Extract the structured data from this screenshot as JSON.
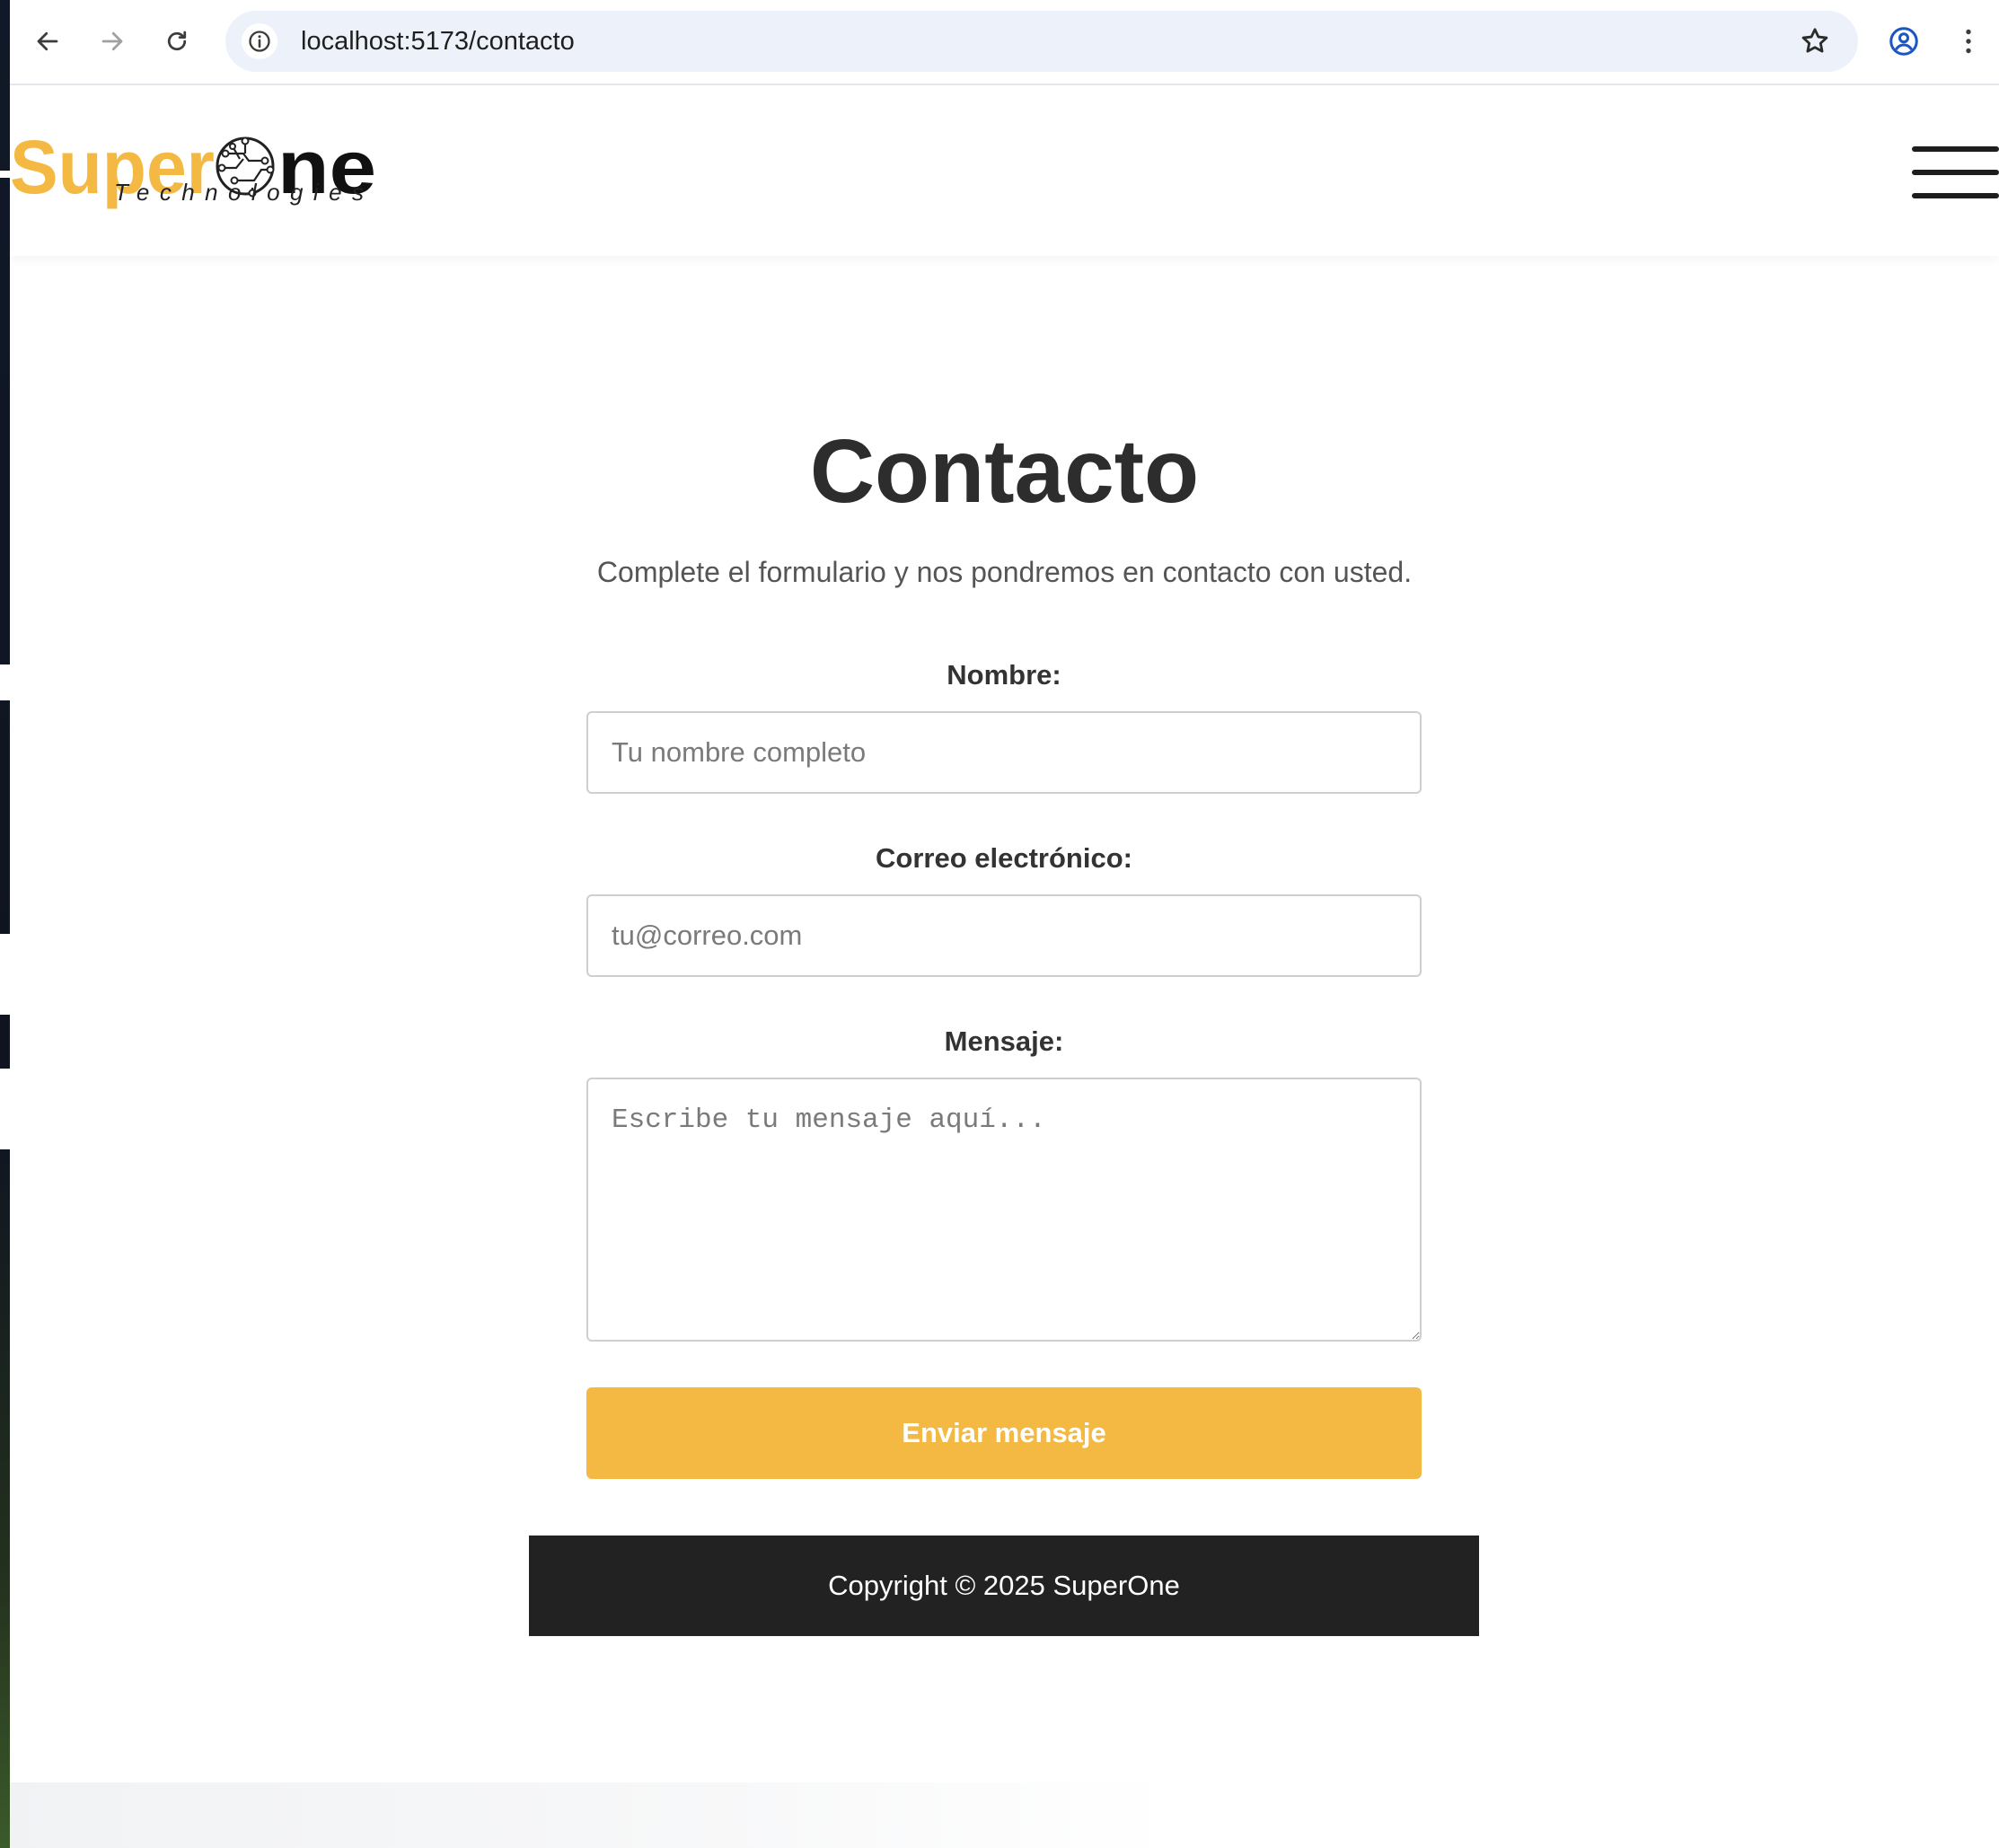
{
  "browser": {
    "url": "localhost:5173/contacto"
  },
  "header": {
    "logo_text": "SuperOne",
    "logo_tagline": "Technologies"
  },
  "main": {
    "title": "Contacto",
    "subtitle": "Complete el formulario y nos pondremos en contacto con usted.",
    "form": {
      "name_label": "Nombre:",
      "name_placeholder": "Tu nombre completo",
      "email_label": "Correo electrónico:",
      "email_placeholder": "tu@correo.com",
      "message_label": "Mensaje:",
      "message_placeholder": "Escribe tu mensaje aquí...",
      "submit_label": "Enviar mensaje"
    }
  },
  "footer": {
    "copyright": "Copyright © 2025 SuperOne"
  },
  "colors": {
    "accent": "#f3b942",
    "footer_bg": "#222222",
    "title": "#2d2d2d"
  },
  "icons": {
    "back": "arrow-left-icon",
    "forward": "arrow-right-icon",
    "reload": "reload-icon",
    "site_info": "info-icon",
    "bookmark": "star-icon",
    "profile": "profile-icon",
    "menu": "kebab-menu-icon",
    "nav_menu": "hamburger-icon"
  }
}
